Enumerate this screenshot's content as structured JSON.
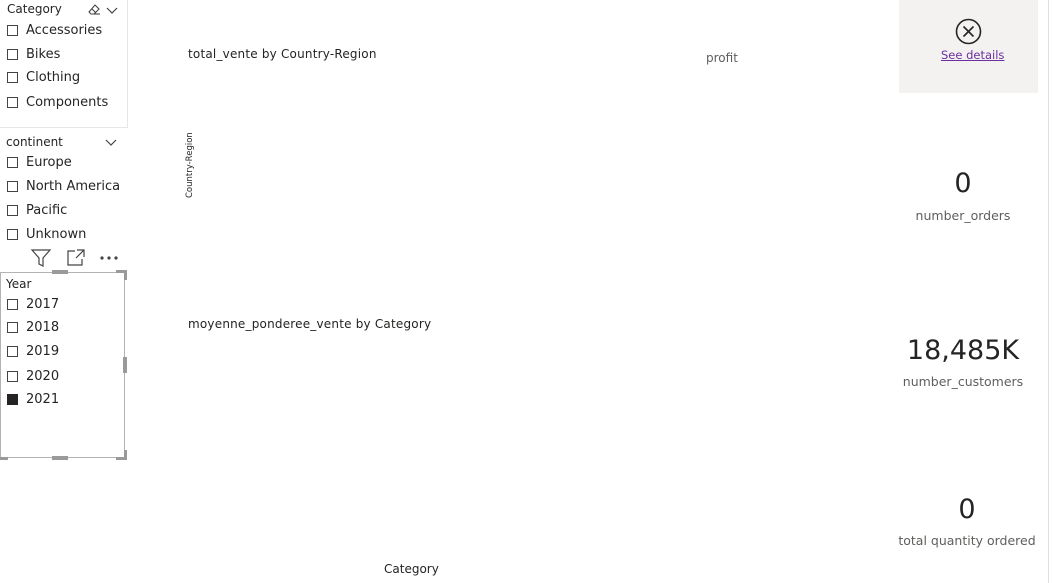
{
  "category_slicer": {
    "title": "Category",
    "items": [
      {
        "label": "Accessories",
        "checked": false
      },
      {
        "label": "Bikes",
        "checked": false
      },
      {
        "label": "Clothing",
        "checked": false
      },
      {
        "label": "Components",
        "checked": false
      }
    ],
    "eraser_icon": "eraser-icon",
    "chevron_icon": "chevron-down-icon"
  },
  "continent_slicer": {
    "title": "continent",
    "items": [
      {
        "label": "Europe",
        "checked": false
      },
      {
        "label": "North America",
        "checked": false
      },
      {
        "label": "Pacific",
        "checked": false
      },
      {
        "label": "Unknown",
        "checked": false
      }
    ]
  },
  "visual_toolbar": {
    "filter_icon": "filter-icon",
    "focus_icon": "focus-mode-icon",
    "more_icon": "more-options-icon"
  },
  "year_slicer": {
    "title": "Year",
    "items": [
      {
        "label": "2017",
        "checked": false
      },
      {
        "label": "2018",
        "checked": false
      },
      {
        "label": "2019",
        "checked": false
      },
      {
        "label": "2020",
        "checked": false
      },
      {
        "label": "2021",
        "checked": true
      }
    ]
  },
  "chart_country": {
    "title": "total_vente by Country-Region",
    "y_axis_title": "Country-Region"
  },
  "chart_profit": {
    "title": "profit"
  },
  "chart_category": {
    "title": "moyenne_ponderee_vente by Category",
    "x_axis_title": "Category"
  },
  "error_card": {
    "link_text": "See details",
    "icon": "close-circle-icon"
  },
  "cards": [
    {
      "value": "0",
      "label": "number_orders"
    },
    {
      "value": "18,485K",
      "label": "number_customers"
    },
    {
      "value": "0",
      "label": "total quantity ordered"
    }
  ],
  "colors": {
    "text": "#252423",
    "label_gray": "#605e5c",
    "link": "#6b2fa0",
    "error_bg": "#f3f2f1"
  }
}
